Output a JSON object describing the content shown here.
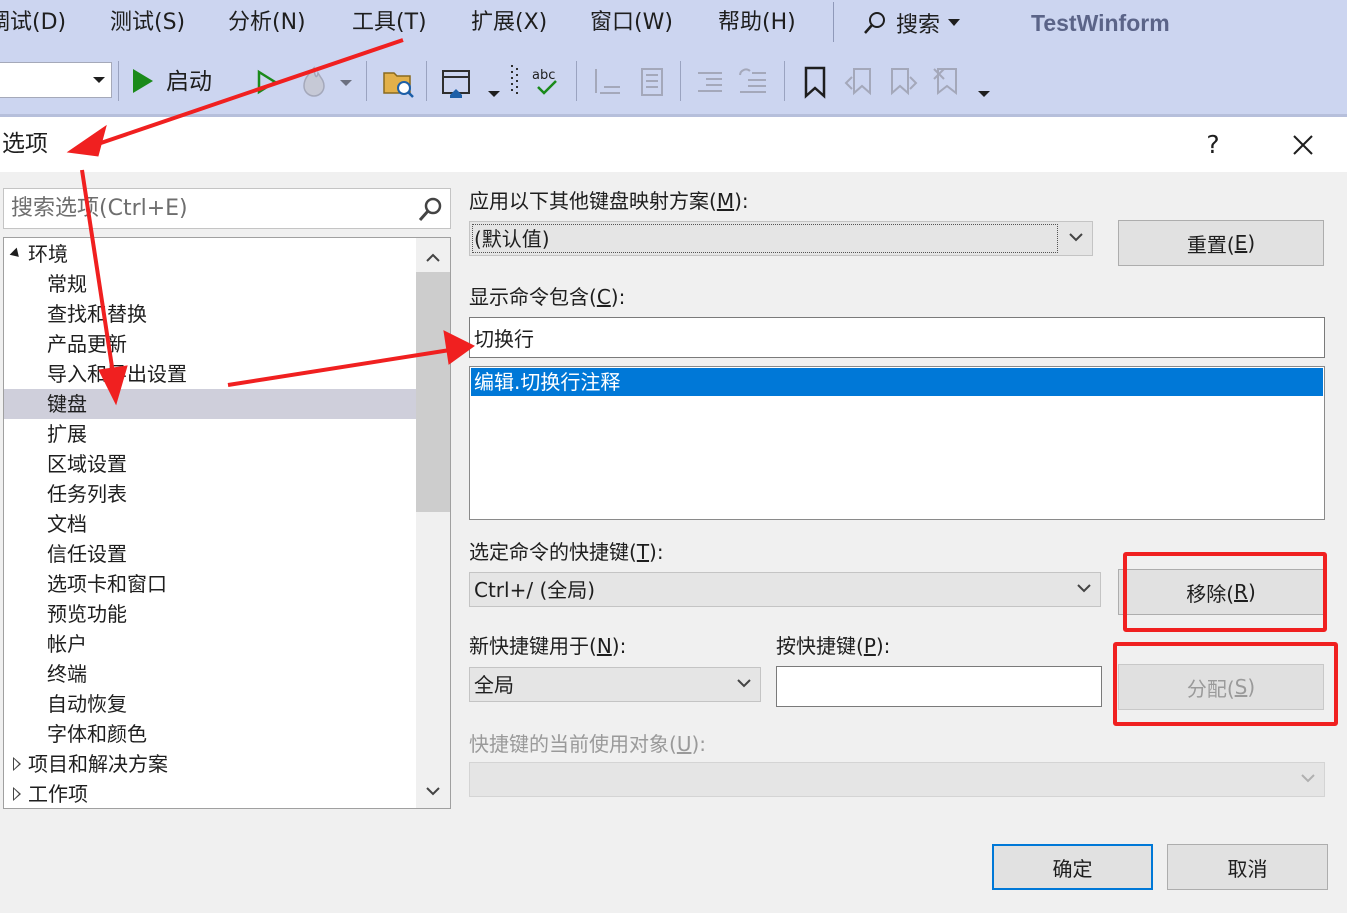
{
  "menubar": {
    "items": [
      "调试(D)",
      "测试(S)",
      "分析(N)",
      "工具(T)",
      "扩展(X)",
      "窗口(W)",
      "帮助(H)"
    ],
    "search_label": "搜索",
    "app_title": "TestWinform"
  },
  "toolbar": {
    "start_label": "启动",
    "icons": [
      "run-icon",
      "run-outline-icon",
      "hot-reload-icon",
      "folder-search-icon",
      "home-window-icon",
      "dotted-separator-icon",
      "spellcheck-icon",
      "comment-lines-icon",
      "uncomment-lines-icon",
      "indent-icon",
      "outdent-icon",
      "bookmark-icon",
      "prev-bookmark-icon",
      "next-bookmark-icon",
      "clear-bookmarks-icon"
    ]
  },
  "dialog": {
    "title": "选项",
    "help": "?",
    "search_placeholder": "搜索选项(Ctrl+E)",
    "tree": {
      "root": "环境",
      "children": [
        "常规",
        "查找和替换",
        "产品更新",
        "导入和导出设置",
        "键盘",
        "扩展",
        "区域设置",
        "任务列表",
        "文档",
        "信任设置",
        "选项卡和窗口",
        "预览功能",
        "帐户",
        "终端",
        "自动恢复",
        "字体和颜色"
      ],
      "collapsed": [
        "项目和解决方案",
        "工作项"
      ],
      "selected": "键盘"
    },
    "mapping": {
      "label": "应用以下其他键盘映射方案(",
      "key": "M",
      "label_end": "):",
      "value": "(默认值)",
      "reset_label": "重置(",
      "reset_key": "E",
      "reset_end": ")"
    },
    "show_commands": {
      "label": "显示命令包含(",
      "key": "C",
      "label_end": "):",
      "value": "切换行"
    },
    "command_list": [
      "编辑.切换行注释"
    ],
    "shortcuts": {
      "label": "选定命令的快捷键(",
      "key": "T",
      "label_end": "):",
      "value": "Ctrl+/ (全局)",
      "remove_label": "移除(",
      "remove_key": "R",
      "remove_end": ")"
    },
    "new_shortcut": {
      "label": "新快捷键用于(",
      "key": "N",
      "label_end": "):",
      "value": "全局"
    },
    "press_keys": {
      "label": "按快捷键(",
      "key": "P",
      "label_end": "):",
      "value": "",
      "assign_label": "分配(",
      "assign_key": "S",
      "assign_end": ")"
    },
    "current_use": {
      "label": "快捷键的当前使用对象(",
      "key": "U",
      "label_end": "):",
      "value": ""
    },
    "ok_label": "确定",
    "cancel_label": "取消"
  },
  "colors": {
    "chrome": "#ccd5f0",
    "selection": "#0078d7",
    "annotation": "#f02020",
    "run_green": "#1a8a1a"
  }
}
